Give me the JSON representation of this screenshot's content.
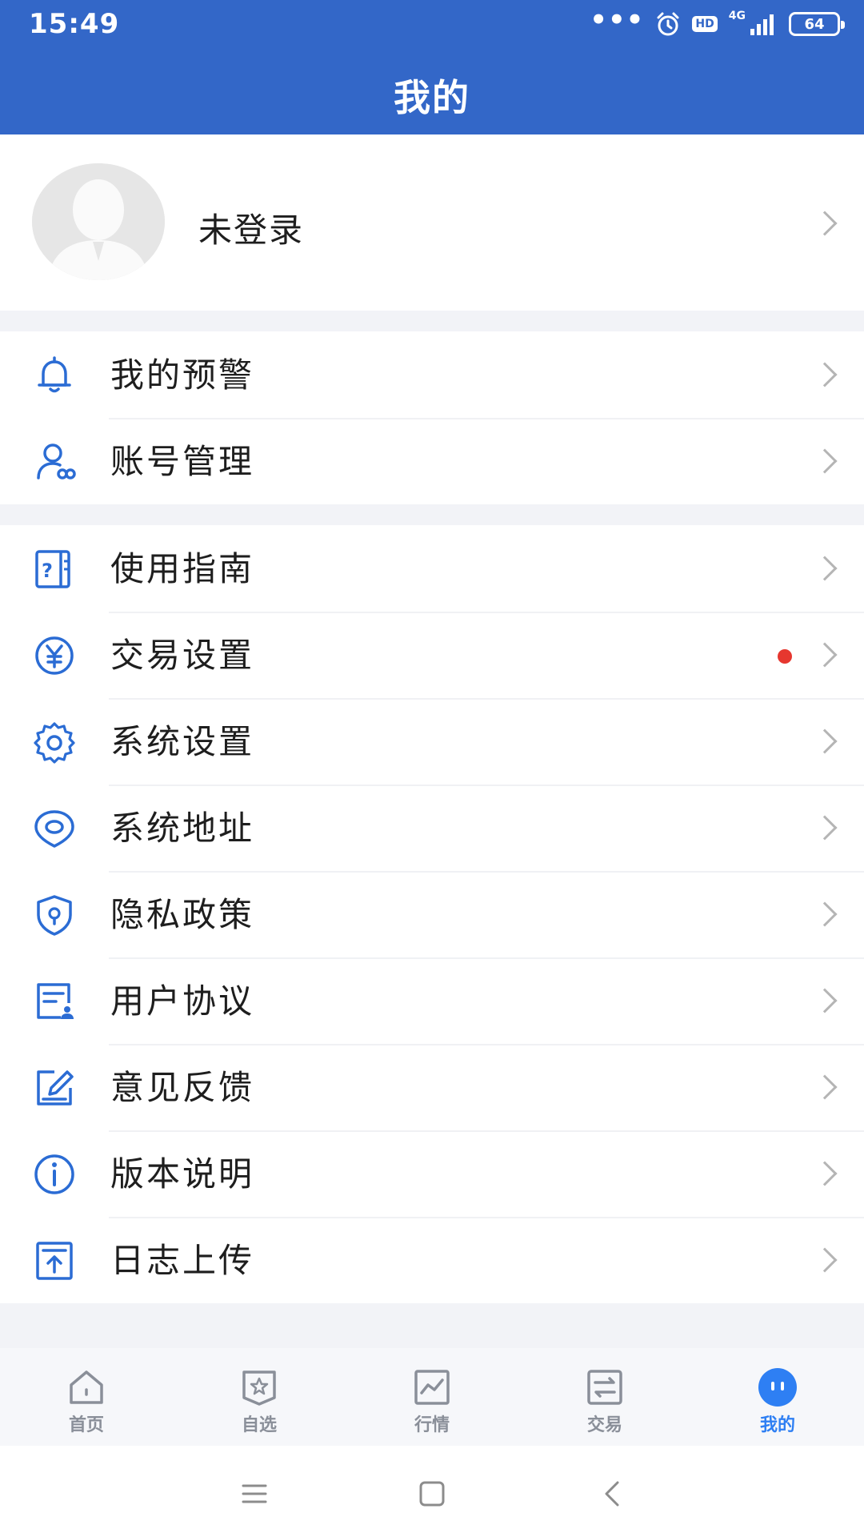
{
  "status_bar": {
    "time": "15:49",
    "dots": "•••",
    "hd": "HD",
    "network": "4G",
    "battery": "64"
  },
  "header": {
    "title": "我的"
  },
  "profile": {
    "label": "未登录"
  },
  "section1": [
    {
      "label": "我的预警",
      "icon": "bell-icon"
    },
    {
      "label": "账号管理",
      "icon": "user-account-icon"
    }
  ],
  "section2": [
    {
      "label": "使用指南",
      "icon": "guide-icon"
    },
    {
      "label": "交易设置",
      "icon": "yuan-icon",
      "badge": "red-dot"
    },
    {
      "label": "系统设置",
      "icon": "gear-icon"
    },
    {
      "label": "系统地址",
      "icon": "location-icon"
    },
    {
      "label": "隐私政策",
      "icon": "shield-lock-icon"
    },
    {
      "label": "用户协议",
      "icon": "agreement-icon"
    },
    {
      "label": "意见反馈",
      "icon": "edit-icon"
    },
    {
      "label": "版本说明",
      "icon": "info-icon"
    },
    {
      "label": "日志上传",
      "icon": "upload-icon"
    }
  ],
  "tabs": [
    {
      "label": "首页",
      "icon": "home-icon"
    },
    {
      "label": "自选",
      "icon": "star-badge-icon"
    },
    {
      "label": "行情",
      "icon": "chart-icon"
    },
    {
      "label": "交易",
      "icon": "exchange-icon"
    },
    {
      "label": "我的",
      "icon": "profile-face-icon",
      "active": true
    }
  ],
  "colors": {
    "header": "#3367c8",
    "icon_blue": "#2b6cd4",
    "active_tab": "#2e7ff3",
    "badge": "#e6372f"
  }
}
